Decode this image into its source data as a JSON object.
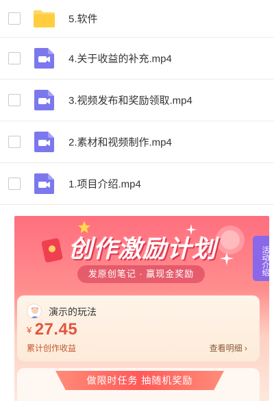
{
  "files": [
    {
      "name": "5.软件",
      "type": "folder",
      "icon": "folder-icon"
    },
    {
      "name": "4.关于收益的补充.mp4",
      "type": "video",
      "icon": "video-file-icon"
    },
    {
      "name": "3.视频发布和奖励领取.mp4",
      "type": "video",
      "icon": "video-file-icon"
    },
    {
      "name": "2.素材和视频制作.mp4",
      "type": "video",
      "icon": "video-file-icon"
    },
    {
      "name": "1.项目介绍.mp4",
      "type": "video",
      "icon": "video-file-icon"
    }
  ],
  "promo": {
    "title": "创作激励计划",
    "subtitle": "发原创笔记 · 赢现金奖励",
    "side_tab": "活动介绍",
    "card": {
      "user_name": "演示的玩法",
      "currency": "¥",
      "amount": "27.45",
      "amount_label": "累计创作收益",
      "detail_link": "查看明细 ›"
    },
    "task_banner": "做限时任务 抽随机奖励"
  },
  "colors": {
    "folder": "#ffd866",
    "video": "#7b78ee",
    "accent": "#e2563b",
    "side_tab": "#8b68e8"
  }
}
